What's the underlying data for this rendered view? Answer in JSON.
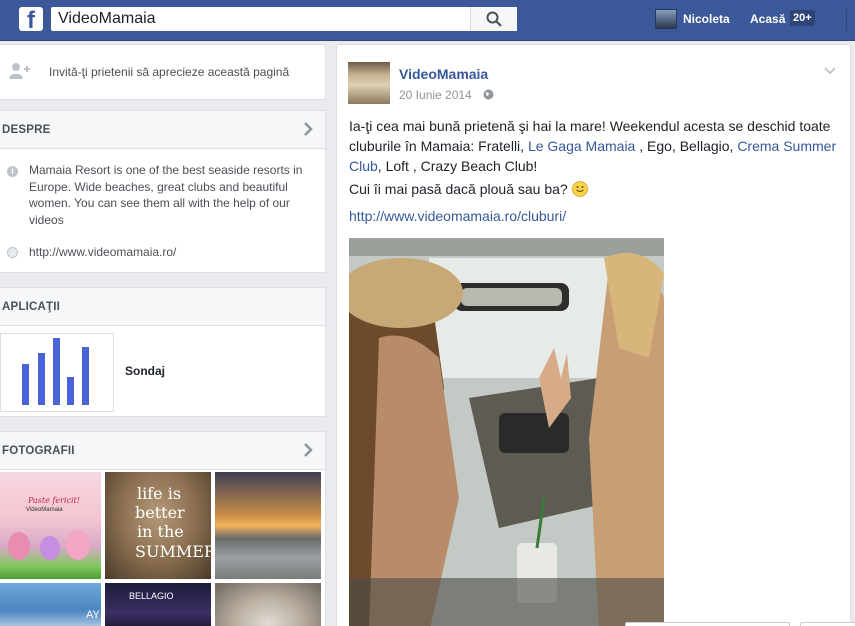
{
  "search": {
    "value": "VideoMamaia"
  },
  "topbar": {
    "user_name": "Nicoleta",
    "home_label": "Acasă",
    "home_count": "20+"
  },
  "invite": {
    "text": "Invită-ţi prietenii să aprecieze această pagină"
  },
  "about": {
    "heading": "DESPRE",
    "description": "Mamaia Resort is one of the best seaside resorts in Europe. Wide beaches, great clubs and beautiful women. You can see them all with the help of our videos",
    "website": "http://www.videomamaia.ro/"
  },
  "apps": {
    "heading": "APLICAŢII",
    "items": [
      {
        "label": "Sondaj"
      }
    ]
  },
  "photos": {
    "heading": "FOTOGRAFII",
    "p1_text": "Paste fericit!",
    "p1_brand": "VideoMamaia",
    "p2_text_1": "life is",
    "p2_text_2": "better",
    "p2_text_3": "in the",
    "p2_text_4": "SUMMER",
    "p5_text": "BELLAGIO",
    "p4_text": "AY"
  },
  "post": {
    "page_name": "VideoMamaia",
    "date": "20 Iunie 2014",
    "text_part1": "Ia-ţi cea mai bună prietenă şi hai la mare! Weekendul acesta se deschid toate cluburile în Mamaia: Fratelli, ",
    "link1": "Le Gaga Mamaia",
    "text_part2": " , Ego, Bellagio, ",
    "link2": "Crema Summer Club",
    "text_part3": ", Loft , Crazy Beach Club!",
    "line2": "Cui îi mai pasă dacă plouă sau ba? ",
    "url": "http://www.videomamaia.ro/cluburi/"
  },
  "colors": {
    "brand": "#3b5998",
    "link": "#365899",
    "page_bg": "#e9ebee"
  }
}
